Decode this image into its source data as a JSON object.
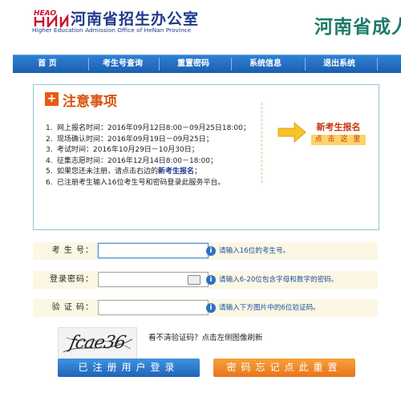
{
  "header": {
    "logo_text": "HEAO",
    "org_cn": "河南省招生办公室",
    "org_en": "Higher Education Admission Office of HeNan Province",
    "banner_right": "河南省成人"
  },
  "nav": {
    "items": [
      {
        "label": "首 页"
      },
      {
        "label": "考生号查询"
      },
      {
        "label": "重置密码"
      },
      {
        "label": "系统信息"
      },
      {
        "label": "退出系统"
      }
    ]
  },
  "notice": {
    "icon": "plus-icon",
    "title": "注意事项",
    "items": [
      {
        "num": "1.",
        "text": "网上报名时间：2016年09月12日8:00－09月25日18:00；"
      },
      {
        "num": "2.",
        "text": "现场确认时间：2016年09月19日－09月25日；"
      },
      {
        "num": "3.",
        "text": "考试时间：2016年10月29日－10月30日；"
      },
      {
        "num": "4.",
        "text": "征集志愿时间：2016年12月14日8:00－18:00；"
      },
      {
        "num": "5.",
        "text_before": "如果您还未注册，请点击右边的",
        "link": "新考生报名",
        "text_after": "；"
      },
      {
        "num": "6.",
        "text": "已注册考生输入16位考生号和密码登录此服务平台。"
      }
    ],
    "new_register": {
      "title": "新考生报名",
      "button": "点 击 这 里"
    }
  },
  "form": {
    "exam_no": {
      "label": "考 生 号：",
      "value": "",
      "hint": "请输入16位的考生号。"
    },
    "password": {
      "label": "登录密码：",
      "value": "",
      "hint": "请输入6-20位包含字母和数字的密码。"
    },
    "captcha": {
      "label": "验 证 码：",
      "value": "",
      "hint": "请输入下方图片中的6位验证码。"
    }
  },
  "captcha": {
    "image_text": "fcae36",
    "hint": "看不清验证码？点击左侧图像刷新"
  },
  "buttons": {
    "login": "已注册用户登录",
    "reset": "密码忘记点此重置"
  },
  "colors": {
    "nav": "#1a5fb0",
    "notice_title": "#d9530f",
    "hint": "#1f4fa0",
    "login_button": "#1f64b8",
    "reset_button": "#e8741c"
  }
}
